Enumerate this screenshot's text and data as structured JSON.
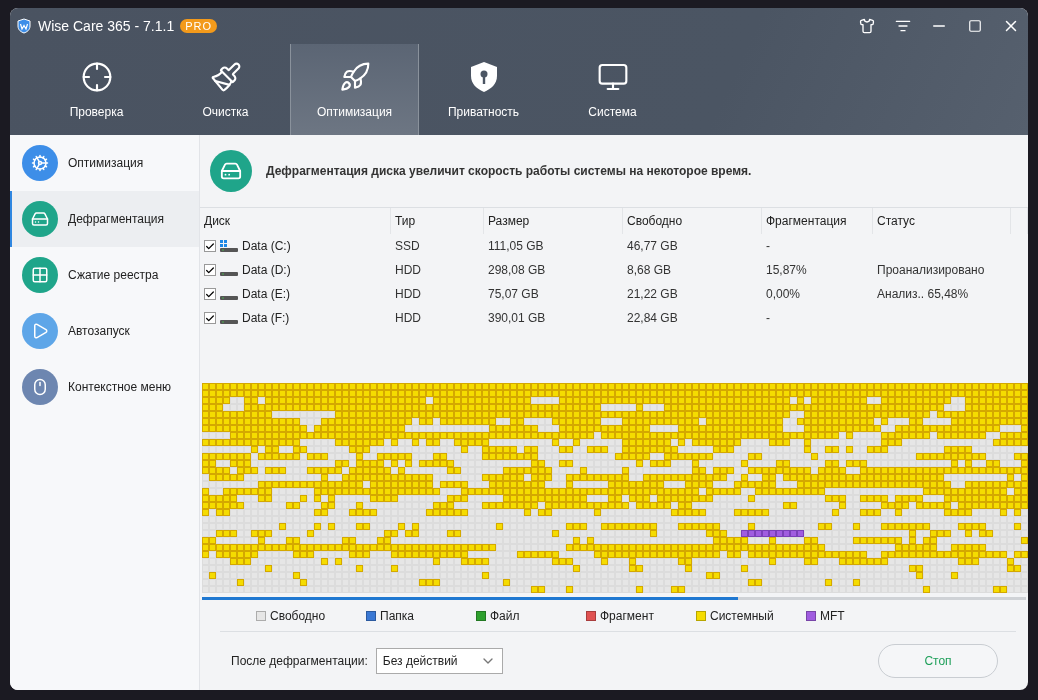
{
  "window": {
    "title": "Wise Care 365 - 7.1.1",
    "badge": "PRO"
  },
  "tabs": [
    {
      "label": "Проверка",
      "selected": false
    },
    {
      "label": "Очистка",
      "selected": false
    },
    {
      "label": "Оптимизация",
      "selected": true
    },
    {
      "label": "Приватность",
      "selected": false
    },
    {
      "label": "Система",
      "selected": false
    }
  ],
  "sidebar": {
    "items": [
      {
        "label": "Оптимизация",
        "selected": false
      },
      {
        "label": "Дефрагментация",
        "selected": true
      },
      {
        "label": "Сжатие реестра",
        "selected": false
      },
      {
        "label": "Автозапуск",
        "selected": false
      },
      {
        "label": "Контекстное меню",
        "selected": false
      }
    ]
  },
  "banner": {
    "text": "Дефрагментация диска увеличит скорость работы системы на некоторое время."
  },
  "table": {
    "columns": [
      "Диск",
      "Тир",
      "Размер",
      "Свободно",
      "Фрагментация",
      "Статус"
    ],
    "rows": [
      {
        "checked": true,
        "system_drive": true,
        "disk": "Data (C:)",
        "type": "SSD",
        "size": "111,05 GB",
        "free": "46,77 GB",
        "fragmentation": "-",
        "status": ""
      },
      {
        "checked": true,
        "system_drive": false,
        "disk": "Data (D:)",
        "type": "HDD",
        "size": "298,08 GB",
        "free": "8,68 GB",
        "fragmentation": "15,87%",
        "status": "Проанализировано"
      },
      {
        "checked": true,
        "system_drive": false,
        "disk": "Data (E:)",
        "type": "HDD",
        "size": "75,07 GB",
        "free": "21,22 GB",
        "fragmentation": "0,00%",
        "status": "Анализ.. 65,48%"
      },
      {
        "checked": true,
        "system_drive": false,
        "disk": "Data (F:)",
        "type": "HDD",
        "size": "390,01 GB",
        "free": "22,84 GB",
        "fragmentation": "-",
        "status": ""
      }
    ]
  },
  "progress": {
    "level": 0.65
  },
  "legend": [
    {
      "label": "Свободно",
      "color": "#e6e6e6"
    },
    {
      "label": "Папка",
      "color": "#3a78d4"
    },
    {
      "label": "Файл",
      "color": "#2ea02e"
    },
    {
      "label": "Фрагмент",
      "color": "#e05252"
    },
    {
      "label": "Системный",
      "color": "#f5dc00"
    },
    {
      "label": "MFT",
      "color": "#a05ce0"
    }
  ],
  "after_defrag": {
    "label": "После дефрагментации:",
    "value": "Без действий"
  },
  "stop_button": {
    "label": "Стоп"
  }
}
